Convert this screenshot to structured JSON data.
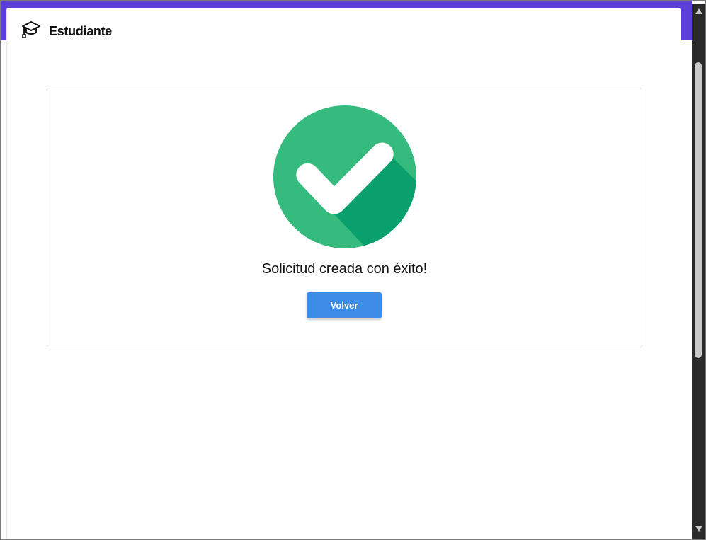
{
  "header": {
    "title": "Estudiante",
    "icon": "graduation-cap-icon"
  },
  "result": {
    "icon": "success-check-icon",
    "message": "Solicitud creada con éxito!",
    "back_label": "Volver"
  },
  "colors": {
    "accent": "#5b3fd6",
    "success_green": "#35bb7e",
    "success_shadow": "#09a06e",
    "button_blue": "#3d8de8"
  }
}
